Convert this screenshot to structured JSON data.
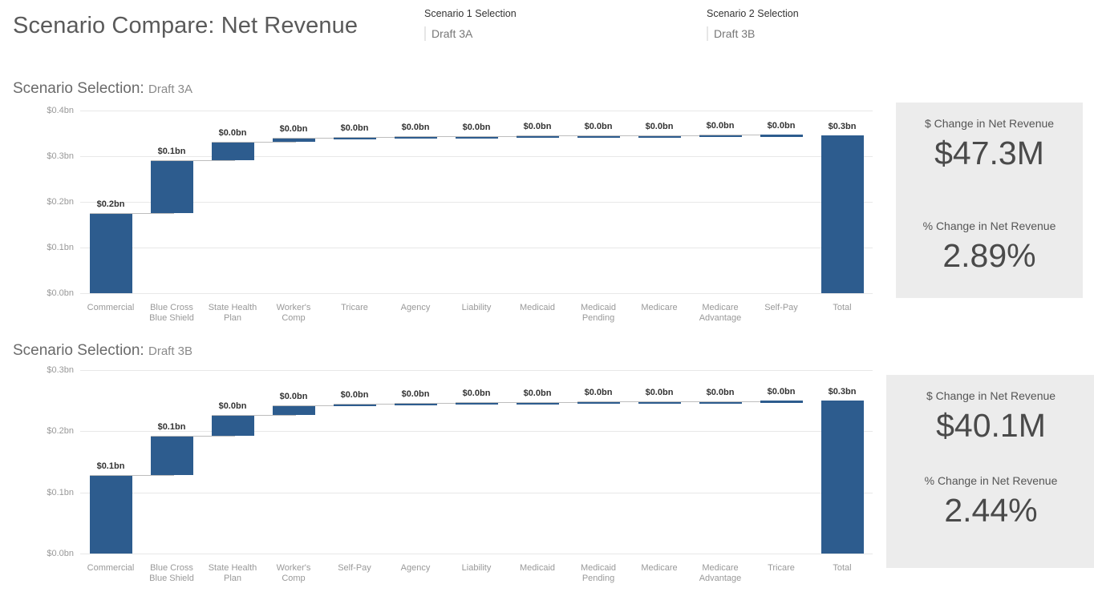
{
  "header": {
    "title": "Scenario Compare: Net Revenue",
    "slicers": [
      {
        "label": "Scenario 1 Selection",
        "value": "Draft 3A"
      },
      {
        "label": "Scenario 2 Selection",
        "value": "Draft 3B"
      }
    ]
  },
  "colors": {
    "bar": "#2d5c8e",
    "card_background": "#ececec",
    "gridline": "#e8e8e8"
  },
  "charts": [
    {
      "heading_prefix": "Scenario Selection:",
      "heading_value": "Draft 3A",
      "kpi": {
        "dollar_title": "$ Change in Net Revenue",
        "dollar_value": "$47.3M",
        "percent_title": "% Change in Net Revenue",
        "percent_value": "2.89%"
      }
    },
    {
      "heading_prefix": "Scenario Selection:",
      "heading_value": "Draft 3B",
      "kpi": {
        "dollar_title": "$ Change in Net Revenue",
        "dollar_value": "$40.1M",
        "percent_title": "% Change in Net Revenue",
        "percent_value": "2.44%"
      }
    }
  ],
  "chart_data": [
    {
      "type": "bar",
      "subtype": "waterfall",
      "title": "Scenario Selection: Draft 3A",
      "xlabel": "",
      "ylabel": "",
      "ylim": [
        0,
        0.4
      ],
      "yticks": [
        "$0.0bn",
        "$0.1bn",
        "$0.2bn",
        "$0.3bn",
        "$0.4bn"
      ],
      "ytick_values": [
        0,
        0.1,
        0.2,
        0.3,
        0.4
      ],
      "grid": true,
      "legend": "none",
      "categories": [
        "Commercial",
        "Blue Cross Blue Shield",
        "State Health Plan",
        "Worker's Comp",
        "Tricare",
        "Agency",
        "Liability",
        "Medicaid",
        "Medicaid Pending",
        "Medicare",
        "Medicare Advantage",
        "Self-Pay",
        "Total"
      ],
      "data_labels": [
        "$0.2bn",
        "$0.1bn",
        "$0.0bn",
        "$0.0bn",
        "$0.0bn",
        "$0.0bn",
        "$0.0bn",
        "$0.0bn",
        "$0.0bn",
        "$0.0bn",
        "$0.0bn",
        "$0.0bn",
        "$0.3bn"
      ],
      "values": [
        0.175,
        0.117,
        0.039,
        0.009,
        0.002,
        0.001,
        0.001,
        0.001,
        0.0005,
        0.0005,
        0.0005,
        0.0005,
        0.346
      ],
      "cumulative_start": [
        0.0,
        0.175,
        0.292,
        0.331,
        0.34,
        0.342,
        0.343,
        0.344,
        0.345,
        0.3455,
        0.346,
        0.3465,
        0.0
      ],
      "cumulative_end": [
        0.175,
        0.292,
        0.331,
        0.34,
        0.342,
        0.343,
        0.344,
        0.345,
        0.3455,
        0.346,
        0.3465,
        0.347,
        0.346
      ],
      "is_total": [
        false,
        false,
        false,
        false,
        false,
        false,
        false,
        false,
        false,
        false,
        false,
        false,
        true
      ]
    },
    {
      "type": "bar",
      "subtype": "waterfall",
      "title": "Scenario Selection: Draft 3B",
      "xlabel": "",
      "ylabel": "",
      "ylim": [
        0,
        0.3
      ],
      "yticks": [
        "$0.0bn",
        "$0.1bn",
        "$0.2bn",
        "$0.3bn"
      ],
      "ytick_values": [
        0,
        0.1,
        0.2,
        0.3
      ],
      "grid": true,
      "legend": "none",
      "categories": [
        "Commercial",
        "Blue Cross Blue Shield",
        "State Health Plan",
        "Worker's Comp",
        "Self-Pay",
        "Agency",
        "Liability",
        "Medicaid",
        "Medicaid Pending",
        "Medicare",
        "Medicare Advantage",
        "Tricare",
        "Total"
      ],
      "data_labels": [
        "$0.1bn",
        "$0.1bn",
        "$0.0bn",
        "$0.0bn",
        "$0.0bn",
        "$0.0bn",
        "$0.0bn",
        "$0.0bn",
        "$0.0bn",
        "$0.0bn",
        "$0.0bn",
        "$0.0bn",
        "$0.3bn"
      ],
      "values": [
        0.129,
        0.063,
        0.035,
        0.015,
        0.003,
        0.001,
        0.001,
        0.001,
        0.0005,
        0.0005,
        0.0005,
        0.0005,
        0.25
      ],
      "cumulative_start": [
        0.0,
        0.129,
        0.192,
        0.227,
        0.242,
        0.245,
        0.246,
        0.247,
        0.248,
        0.2485,
        0.249,
        0.2495,
        0.0
      ],
      "cumulative_end": [
        0.129,
        0.192,
        0.227,
        0.242,
        0.245,
        0.246,
        0.247,
        0.248,
        0.2485,
        0.249,
        0.2495,
        0.25,
        0.25
      ],
      "is_total": [
        false,
        false,
        false,
        false,
        false,
        false,
        false,
        false,
        false,
        false,
        false,
        false,
        true
      ]
    }
  ]
}
